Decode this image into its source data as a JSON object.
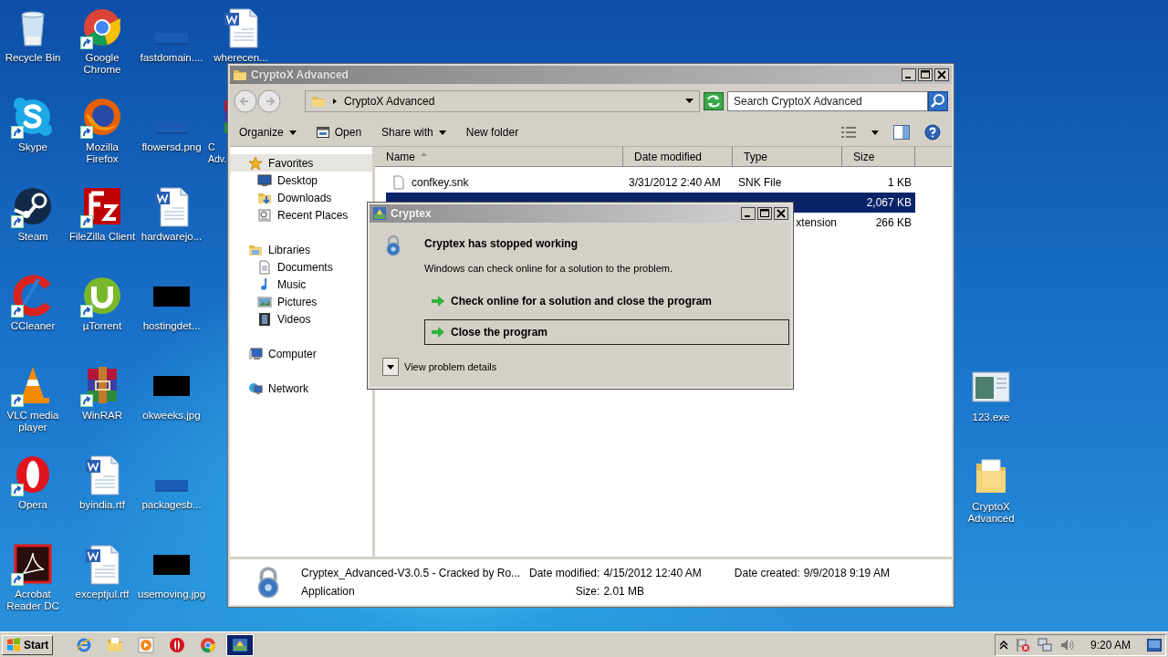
{
  "desktop": {
    "columns": [
      [
        {
          "label": "Recycle Bin",
          "kind": "recycle",
          "shortcut": false
        },
        {
          "label": "Skype",
          "kind": "skype",
          "shortcut": true
        },
        {
          "label": "Steam",
          "kind": "steam",
          "shortcut": true
        },
        {
          "label": "CCleaner",
          "kind": "ccleaner",
          "shortcut": true
        },
        {
          "label": "VLC media player",
          "kind": "vlc",
          "shortcut": true
        },
        {
          "label": "Opera",
          "kind": "opera",
          "shortcut": true
        },
        {
          "label": "Acrobat Reader DC",
          "kind": "acrobat",
          "shortcut": true
        }
      ],
      [
        {
          "label": "Google Chrome",
          "kind": "chrome",
          "shortcut": true
        },
        {
          "label": "Mozilla Firefox",
          "kind": "firefox",
          "shortcut": true
        },
        {
          "label": "FileZilla Client",
          "kind": "filezilla",
          "shortcut": true
        },
        {
          "label": "µTorrent",
          "kind": "utorrent",
          "shortcut": true
        },
        {
          "label": "WinRAR",
          "kind": "winrar",
          "shortcut": true
        },
        {
          "label": "byindia.rtf",
          "kind": "word",
          "shortcut": false
        },
        {
          "label": "exceptjul.rtf",
          "kind": "word",
          "shortcut": false
        }
      ],
      [
        {
          "label": "fastdomain....",
          "kind": "blank",
          "shortcut": false
        },
        {
          "label": "flowersd.png",
          "kind": "blank",
          "shortcut": false
        },
        {
          "label": "hardwarejo...",
          "kind": "word",
          "shortcut": false
        },
        {
          "label": "hostingdet...",
          "kind": "dark",
          "shortcut": false
        },
        {
          "label": "okweeks.jpg",
          "kind": "dark",
          "shortcut": false
        },
        {
          "label": "packagesb...",
          "kind": "blank",
          "shortcut": false
        },
        {
          "label": "usemoving.jpg",
          "kind": "dark",
          "shortcut": false
        }
      ],
      [
        {
          "label": "wherecen...",
          "kind": "word",
          "shortcut": false
        },
        {
          "label": "C Adv.",
          "kind": "winrar",
          "shortcut": false,
          "partial": true
        }
      ]
    ],
    "right_column": [
      {
        "label": "123.exe",
        "kind": "exe",
        "shortcut": false
      },
      {
        "label": "CryptoX Advanced",
        "kind": "folder",
        "shortcut": false
      }
    ]
  },
  "explorer": {
    "title": "CryptoX Advanced",
    "address": "CryptoX Advanced",
    "search": {
      "placeholder": "Search CryptoX Advanced"
    },
    "toolbar": [
      {
        "label": "Organize",
        "kind": "menu"
      },
      {
        "label": "Open",
        "kind": "open"
      },
      {
        "label": "Share with",
        "kind": "menu"
      },
      {
        "label": "New folder",
        "kind": "plain"
      }
    ],
    "nav": [
      {
        "label": "Favorites",
        "kind": "star",
        "selected": true,
        "children": [
          {
            "label": "Desktop",
            "kind": "desktop",
            "selected": false
          },
          {
            "label": "Downloads",
            "kind": "downloads",
            "selected": false
          },
          {
            "label": "Recent Places",
            "kind": "recent",
            "selected": false
          }
        ]
      },
      {
        "label": "Libraries",
        "kind": "libraries",
        "selected": false,
        "children": [
          {
            "label": "Documents",
            "kind": "documents",
            "selected": false
          },
          {
            "label": "Music",
            "kind": "music",
            "selected": false
          },
          {
            "label": "Pictures",
            "kind": "pictures",
            "selected": false
          },
          {
            "label": "Videos",
            "kind": "videos",
            "selected": false
          }
        ]
      },
      {
        "label": "Computer",
        "kind": "computer",
        "selected": false
      },
      {
        "label": "Network",
        "kind": "network",
        "selected": false
      }
    ],
    "columns": [
      {
        "label": "Name",
        "sorted": true
      },
      {
        "label": "Date modified",
        "sorted": false
      },
      {
        "label": "Type",
        "sorted": false
      },
      {
        "label": "Size",
        "sorted": false
      }
    ],
    "rows": [
      {
        "name": "confkey.snk",
        "kind": "file",
        "date": "3/31/2012 2:40 AM",
        "type": "SNK File",
        "size": "1 KB",
        "selected": false
      },
      {
        "size": "2,067 KB",
        "selected": true
      },
      {
        "type": "xtension",
        "size": "266 KB",
        "selected": false
      }
    ],
    "details": {
      "name": "Cryptex_Advanced-V3.0.5 - Cracked by Ro...",
      "type": "Application",
      "groups": [
        [
          {
            "label": "Date modified:",
            "value": "4/15/2012 12:40 AM"
          },
          {
            "label": "Size:",
            "value": "2.01 MB"
          }
        ],
        [
          {
            "label": "Date created:",
            "value": "9/9/2018 9:19 AM"
          }
        ]
      ]
    }
  },
  "dialog": {
    "title": "Cryptex",
    "heading": "Cryptex has stopped working",
    "message": "Windows can check online for a solution to the problem.",
    "options": [
      {
        "label": "Check online for a solution and close the program",
        "selected": false
      },
      {
        "label": "Close the program",
        "selected": true
      }
    ],
    "details_toggle": "View problem details"
  },
  "taskbar": {
    "start": "Start",
    "apps": [
      {
        "kind": "ie",
        "active": false
      },
      {
        "kind": "explorer",
        "active": false
      },
      {
        "kind": "media",
        "active": false
      },
      {
        "kind": "opera",
        "active": false
      },
      {
        "kind": "chrome",
        "active": false
      },
      {
        "kind": "cryptex",
        "active": true
      }
    ],
    "clock": "9:20 AM"
  }
}
